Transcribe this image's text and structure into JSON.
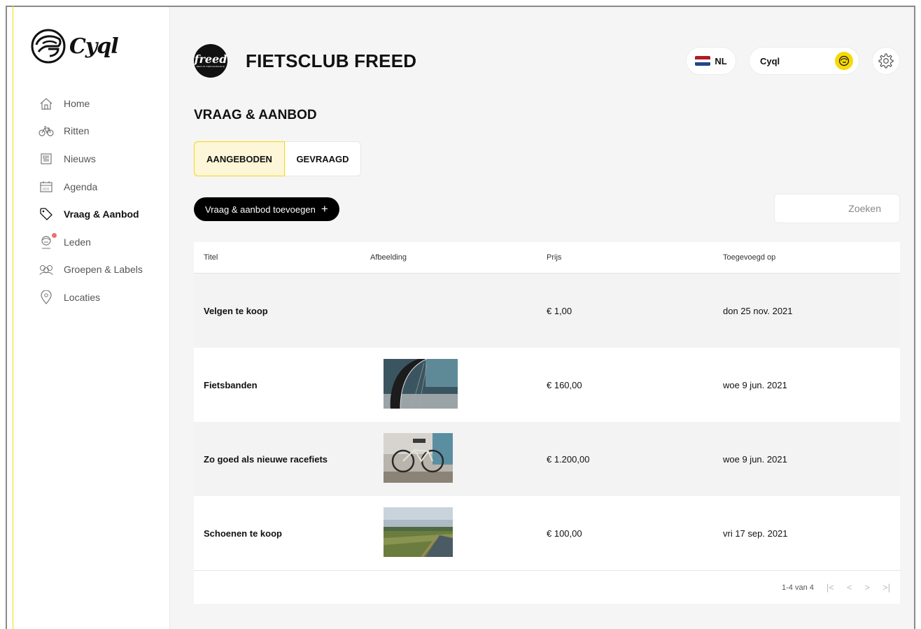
{
  "app": {
    "logo_text": "Cyql"
  },
  "sidebar": {
    "items": [
      {
        "label": "Home",
        "icon": "home-icon",
        "active": false
      },
      {
        "label": "Ritten",
        "icon": "bike-icon",
        "active": false
      },
      {
        "label": "Nieuws",
        "icon": "newspaper-icon",
        "active": false
      },
      {
        "label": "Agenda",
        "icon": "calendar-icon",
        "active": false
      },
      {
        "label": "Vraag & Aanbod",
        "icon": "tag-icon",
        "active": true
      },
      {
        "label": "Leden",
        "icon": "member-icon",
        "active": false,
        "badge_dot": true
      },
      {
        "label": "Groepen & Labels",
        "icon": "group-icon",
        "active": false
      },
      {
        "label": "Locaties",
        "icon": "location-pin-icon",
        "active": false
      }
    ]
  },
  "header": {
    "club_logo_text": "freed",
    "club_logo_subtext": "BERLIN PERFORMANCE",
    "club_name": "FIETSCLUB FREED",
    "language": "NL",
    "user_name": "Cyql"
  },
  "page": {
    "title": "VRAAG & AANBOD",
    "tabs": [
      {
        "label": "AANGEBODEN",
        "active": true
      },
      {
        "label": "GEVRAAGD",
        "active": false
      }
    ],
    "add_button": "Vraag & aanbod toevoegen",
    "add_button_icon": "+",
    "search_placeholder": "Zoeken"
  },
  "table": {
    "columns": [
      "Titel",
      "Afbeelding",
      "Prijs",
      "Toegevoegd op"
    ],
    "rows": [
      {
        "title": "Velgen te koop",
        "image": "",
        "price": "€ 1,00",
        "date": "don 25 nov. 2021"
      },
      {
        "title": "Fietsbanden",
        "image": "tire-photo",
        "price": "€ 160,00",
        "date": "woe 9 jun. 2021"
      },
      {
        "title": "Zo goed als nieuwe racefiets",
        "image": "racebike-photo",
        "price": "€ 1.200,00",
        "date": "woe 9 jun. 2021"
      },
      {
        "title": "Schoenen te koop",
        "image": "landscape-photo",
        "price": "€ 100,00",
        "date": "vri 17 sep. 2021"
      }
    ],
    "pagination": {
      "range": "1-4 van 4",
      "first": "|<",
      "prev": "<",
      "next": ">",
      "last": ">|"
    }
  },
  "colors": {
    "accent": "#f5d90a",
    "tab_active_bg": "#fdf6d8",
    "primary_button": "#000000",
    "badge": "#e57373"
  }
}
